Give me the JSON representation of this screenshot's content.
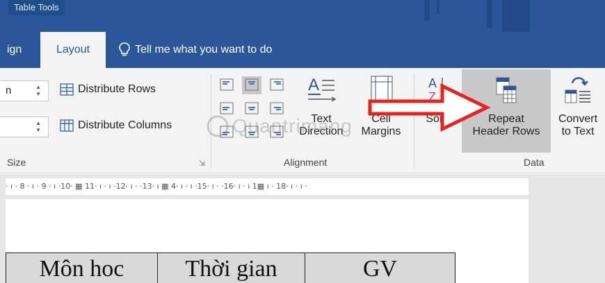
{
  "title_bar": {
    "context_title": "Table Tools"
  },
  "tabs": [
    {
      "label": "ign"
    },
    {
      "label": "Layout"
    }
  ],
  "tell_me": {
    "text": "Tell me what you want to do"
  },
  "cell_size": {
    "height_value": "n",
    "width_value": "",
    "distribute_rows": "Distribute Rows",
    "distribute_columns": "Distribute Columns",
    "group_label": "Size"
  },
  "alignment": {
    "text_direction_line1": "Text",
    "text_direction_line2": "Direction",
    "cell_margins_line1": "Cell",
    "cell_margins_line2": "Margins",
    "group_label": "Alignment"
  },
  "data_group": {
    "sort": "Sort",
    "repeat_line1": "Repeat",
    "repeat_line2": "Header Rows",
    "convert_line1": "Convert",
    "convert_line2": "to Text",
    "group_label": "Data"
  },
  "watermark": "Quantrimang",
  "ruler": {
    "text": "· ı · 8 · ı · 9 · ı ·10·  ▦  11· ı · ı ·12· ı · ·13· ı  ▦ 4· ı · ı ·15· ı · ·16· ı · ı 1▦  ı · 18· ı · ı ·"
  },
  "document_table": {
    "headers": [
      "Môn hoc",
      "Thời gian",
      "GV"
    ]
  },
  "colors": {
    "ribbon_blue": "#2b579a",
    "arrow_red": "#e8231f"
  }
}
